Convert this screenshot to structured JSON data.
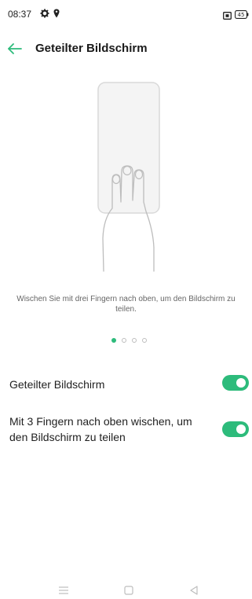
{
  "status_bar": {
    "time": "08:37",
    "icons": [
      "gear-icon",
      "location-pin-icon",
      "screenshot-icon",
      "battery-icon"
    ],
    "battery_level": "45"
  },
  "app_bar": {
    "back_icon": "arrow-left-icon",
    "title": "Geteilter Bildschirm"
  },
  "illustration": {
    "icon": "three-finger-swipe-up-illustration"
  },
  "caption": "Wischen Sie mit drei Fingern nach oben, um den Bildschirm zu teilen.",
  "pager": {
    "total": 4,
    "active_index": 0
  },
  "settings": [
    {
      "label": "Geteilter Bildschirm",
      "enabled": true
    },
    {
      "label": "Mit 3 Fingern nach oben wischen, um den Bildschirm zu teilen",
      "enabled": true
    }
  ],
  "nav_bar": {
    "icons": [
      "menu-icon",
      "home-square-icon",
      "back-triangle-icon"
    ]
  },
  "colors": {
    "accent": "#2dbb7b",
    "title": "#1a1a1a",
    "caption": "#666666"
  }
}
